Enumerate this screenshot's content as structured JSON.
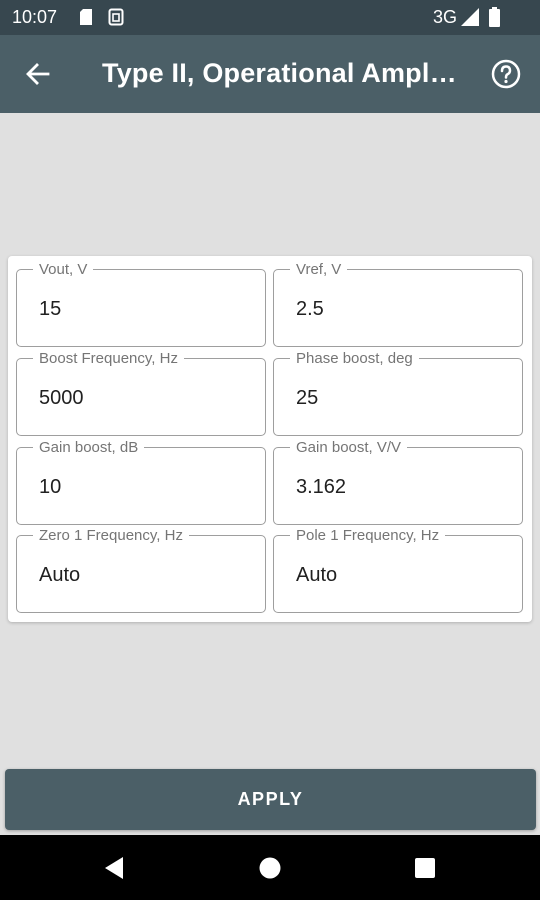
{
  "status_bar": {
    "time": "10:07",
    "network": "3G"
  },
  "app_bar": {
    "title": "Type II, Operational Ampli…"
  },
  "fields": [
    {
      "label": "Vout, V",
      "value": "15"
    },
    {
      "label": "Vref, V",
      "value": "2.5"
    },
    {
      "label": "Boost Frequency, Hz",
      "value": "5000"
    },
    {
      "label": "Phase boost, deg",
      "value": "25"
    },
    {
      "label": "Gain boost, dB",
      "value": "10"
    },
    {
      "label": "Gain boost, V/V",
      "value": "3.162"
    },
    {
      "label": "Zero 1 Frequency, Hz",
      "value": "Auto"
    },
    {
      "label": "Pole 1 Frequency, Hz",
      "value": "Auto"
    }
  ],
  "apply_label": "APPLY",
  "icons": [
    "sd-card-icon",
    "sim-icon",
    "signal-icon",
    "battery-icon",
    "back-arrow-icon",
    "help-icon",
    "nav-back-icon",
    "nav-home-icon",
    "nav-recents-icon"
  ],
  "colors": {
    "status_bar": "#37474f",
    "app_bar": "#4b5f67",
    "background": "#e0e0e0",
    "apply_button": "#4b5f67"
  }
}
